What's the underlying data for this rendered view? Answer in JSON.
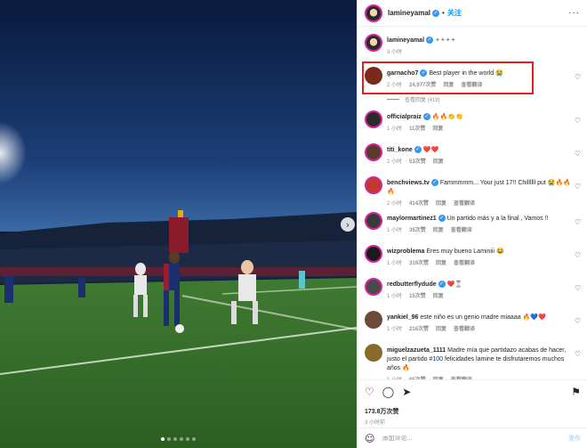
{
  "header": {
    "username": "lamineyamal",
    "separator": "•",
    "follow_label": "关注",
    "more_glyph": "···"
  },
  "caption": {
    "username": "lamineyamal",
    "text": "✦✦✦✦",
    "time": "3 小时"
  },
  "comments": [
    {
      "username": "garnacho7",
      "text": "Best player in the world 😭",
      "time": "2 小时",
      "likes": "24,977次赞",
      "reply": "回复",
      "translate": "查看翻译",
      "verified": true,
      "highlighted": true,
      "avatar_color": "#7a2a1a"
    },
    {
      "username": "officialpraiz",
      "text": "🔥🔥👏👏",
      "time": "1 小时",
      "likes": "11次赞",
      "reply": "回复",
      "verified": true,
      "avatar_color": "#2b2b2b"
    },
    {
      "username": "titi_kone",
      "text": "❤️❤️",
      "time": "2 小时",
      "likes": "53次赞",
      "reply": "回复",
      "verified": true,
      "avatar_color": "#5a3b2a"
    },
    {
      "username": "benchviews.tv",
      "text": "Fammmmm... Your just 17!! Chillllll put 😭🔥🔥🔥",
      "time": "2 小时",
      "likes": "414次赞",
      "reply": "回复",
      "translate": "查看翻译",
      "verified": true,
      "avatar_color": "#c0392b"
    },
    {
      "username": "maylormartinez1",
      "text": "Un partido más y a la final , Vamos !!",
      "time": "1 小时",
      "likes": "35次赞",
      "reply": "回复",
      "translate": "查看翻译",
      "verified": true,
      "avatar_color": "#3a3a3a"
    },
    {
      "username": "wizproblema",
      "text": "Eres muy bueno Laminiii 😂",
      "time": "1 小时",
      "likes": "319次赞",
      "reply": "回复",
      "translate": "查看翻译",
      "verified": false,
      "avatar_color": "#1a1a1a"
    },
    {
      "username": "redbutterflydude",
      "text": "❤️⏳",
      "time": "1 小时",
      "likes": "15次赞",
      "reply": "回复",
      "verified": true,
      "avatar_color": "#4a4a4a"
    },
    {
      "username": "yankiel_96",
      "text": "este niño es un genio madre miaaaa 🔥💙❤️",
      "time": "1 小时",
      "likes": "216次赞",
      "reply": "回复",
      "translate": "查看翻译",
      "verified": false,
      "avatar_color": "#6b4a3a"
    },
    {
      "username": "miguelzazueta_1111",
      "text_before": "Madre mía que partidazo acabas de hacer, justo el partido",
      "hashtag": "#100",
      "text_after": "felicidades lamine te disfrutaremos muchos años 🔥",
      "time": "1 小时",
      "likes": "65次赞",
      "reply": "回复",
      "translate": "查看翻译",
      "verified": false,
      "avatar_color": "#8a6a2a"
    }
  ],
  "view_replies": "查看回复 (419)",
  "post": {
    "likes": "173.8万次赞",
    "time": "3 小时前"
  },
  "composer": {
    "placeholder": "添加评论...",
    "post_label": "发布"
  },
  "icons": {
    "like": "heart-icon",
    "comment": "comment-icon",
    "share": "share-icon",
    "save": "bookmark-icon",
    "next": "chevron-right-icon",
    "emoji": "emoji-icon"
  },
  "colors": {
    "accent": "#0095f6",
    "highlight_border": "#e0201c",
    "verified": "#3897f0"
  },
  "carousel": {
    "count": 6,
    "active_index": 0
  }
}
